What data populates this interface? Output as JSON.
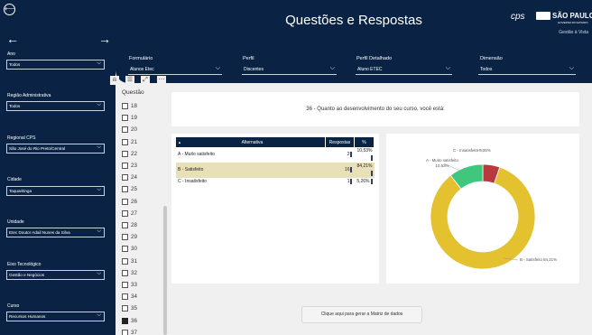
{
  "header": {
    "title": "Questões e Respostas",
    "cps_logo": "cps",
    "sp_logo": "SÃO PAULO",
    "sp_sub": "GOVERNO DO ESTADO",
    "gestao": "Gestão à Vista"
  },
  "sidebar": {
    "filters": [
      {
        "label": "Ano",
        "value": "Todos"
      },
      {
        "label": "Região Administrativa",
        "value": "Todos"
      },
      {
        "label": "Regional CPS",
        "value": "São José do Rio Preto/Central"
      },
      {
        "label": "Cidade",
        "value": "Taquaritinga"
      },
      {
        "label": "Unidade",
        "value": "Etec Doutor Adail Nunes da Silva"
      },
      {
        "label": "Eixo Tecnológico",
        "value": "Gestão e Negócios"
      },
      {
        "label": "Curso",
        "value": "Recursos Humanos"
      }
    ]
  },
  "topfilters": [
    {
      "label": "Formulário",
      "value": "Alunos Etec"
    },
    {
      "label": "Perfil",
      "value": "Discentes"
    },
    {
      "label": "Perfil Detalhado",
      "value": "Aluno ETEC"
    },
    {
      "label": "Dimensão",
      "value": "Todos"
    }
  ],
  "questions": {
    "header": "Questão",
    "items": [
      "18",
      "19",
      "20",
      "21",
      "22",
      "23",
      "24",
      "25",
      "26",
      "27",
      "28",
      "29",
      "30",
      "31",
      "32",
      "33",
      "34",
      "35",
      "36",
      "37"
    ],
    "selected": "36"
  },
  "question_text": "36 - Quanto ao desenvolvimento do seu curso, você está:",
  "table": {
    "headers": [
      "Alternativa",
      "Respostas",
      "%"
    ],
    "rows": [
      {
        "alt": "A - Muito satisfeito",
        "resp": "2",
        "pct": "10,53%"
      },
      {
        "alt": "B - Satisfeito",
        "resp": "16",
        "pct": "84,21%"
      },
      {
        "alt": "C - Insatisfeito",
        "resp": "1",
        "pct": "5,26%"
      }
    ]
  },
  "button_label": "Clique aqui para gerar a Matriz de dados",
  "chart_data": {
    "type": "pie",
    "categories": [
      "A - Muito satisfeito",
      "B - Satisfeito",
      "C - Insatisfeito"
    ],
    "values": [
      10.53,
      84.21,
      5.26
    ],
    "labels": [
      "A - Muito satisfeito 10,53%",
      "B - Satisfeito 84,21%",
      "C - Insatisfeito 5,26%"
    ],
    "colors": [
      "#3fc77d",
      "#e3c12f",
      "#b8393f"
    ]
  }
}
